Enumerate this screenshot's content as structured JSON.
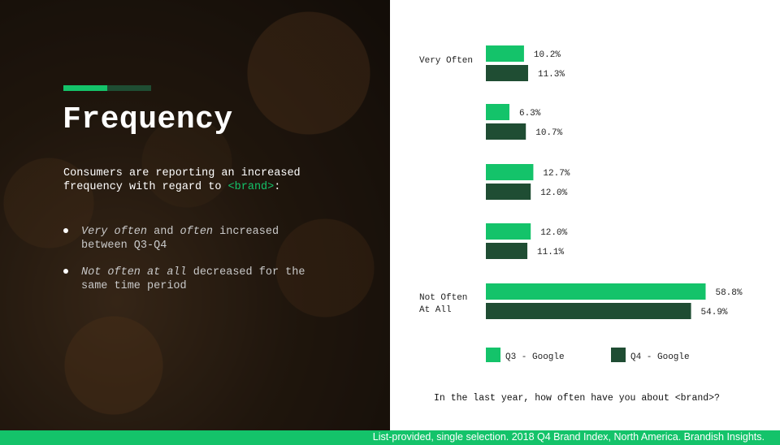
{
  "slide": {
    "title": "Frequency",
    "intro_text": "Consumers are reporting an increased frequency with regard to ",
    "brand_tag": "<brand>",
    "intro_end": ":",
    "bullets": [
      {
        "italic": "Very often",
        "mid": " and ",
        "italic2": "often",
        "rest": " increased between Q3-Q4"
      },
      {
        "italic": "Not often at all",
        "mid": "",
        "italic2": "",
        "rest": " decreased for the same time period"
      }
    ],
    "colors": {
      "accent_green": "#14c36a",
      "dark_green": "#1f4d33",
      "background": "#ffffff"
    }
  },
  "chart_data": {
    "type": "bar",
    "orientation": "horizontal",
    "categories": [
      "Very Often",
      "",
      "",
      "",
      "Not Often At All"
    ],
    "series": [
      {
        "name": "Q3 - Google",
        "values": [
          10.2,
          6.3,
          12.7,
          12.0,
          58.8
        ],
        "labels": [
          "10.2%",
          "6.3%",
          "12.7%",
          "12.0%",
          "58.8%"
        ],
        "color": "#14c36a"
      },
      {
        "name": "Q4 - Google",
        "values": [
          11.3,
          10.7,
          12.0,
          11.1,
          54.9
        ],
        "labels": [
          "11.3%",
          "10.7%",
          "12.0%",
          "11.1%",
          "54.9%"
        ],
        "color": "#1f4d33"
      }
    ],
    "xlim": [
      0,
      60
    ],
    "grid": false,
    "legend_position": "bottom",
    "question": "In the last year, how often have you about <brand>?"
  },
  "footer": {
    "source": "List-provided, single selection.  2018 Q4 Brand Index, North America. Brandish Insights."
  }
}
